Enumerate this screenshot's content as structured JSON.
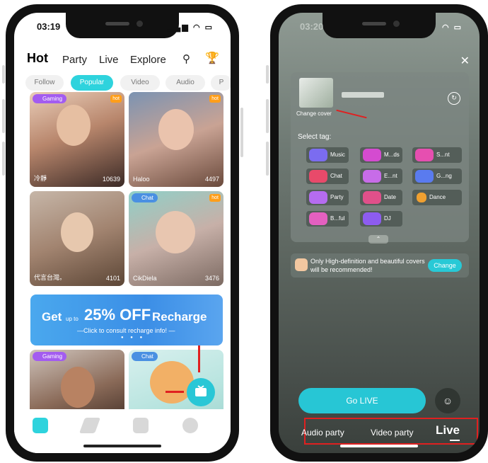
{
  "phone_a": {
    "status": {
      "time": "03:19"
    },
    "nav": {
      "hot": "Hot",
      "party": "Party",
      "live": "Live",
      "explore": "Explore"
    },
    "chips": [
      "Follow",
      "Popular",
      "Video",
      "Audio",
      "P"
    ],
    "cards": [
      {
        "badge": "Gaming",
        "fire": "hot",
        "name": "冷靜",
        "views": "10639"
      },
      {
        "badge": "",
        "fire": "hot",
        "name": "Haloo",
        "views": "4497"
      },
      {
        "badge": "",
        "fire": "",
        "name": "代言台灣。",
        "views": "4101"
      },
      {
        "badge": "Chat",
        "fire": "hot",
        "name": "CikDiela",
        "views": "3476"
      },
      {
        "badge": "Gaming",
        "fire": "",
        "name": "",
        "views": ""
      },
      {
        "badge": "Chat",
        "fire": "",
        "name": "",
        "views": ""
      }
    ],
    "banner": {
      "get": "Get",
      "upto": "up to",
      "offer": "25% OFF",
      "recharge": "Recharge",
      "sub": "—Click to consult recharge info! —"
    }
  },
  "phone_b": {
    "status": {
      "time": "03:20"
    },
    "change_cover": "Change cover",
    "select_tag": "Select tag:",
    "tags": [
      {
        "label": "Music",
        "color": "#7b6cf0"
      },
      {
        "label": "M...ds",
        "color": "#d44bd0"
      },
      {
        "label": "S...nt",
        "color": "#e64fb0"
      },
      {
        "label": "Chat",
        "color": "#e84a6a"
      },
      {
        "label": "E...nt",
        "color": "#c76ce8"
      },
      {
        "label": "G...ng",
        "color": "#5a7bef"
      },
      {
        "label": "Party",
        "color": "#b56cf0"
      },
      {
        "label": "Date",
        "color": "#e0508a"
      },
      {
        "label": "Dance",
        "color": "#f0a030"
      },
      {
        "label": "B...ful",
        "color": "#e460c0"
      },
      {
        "label": "DJ",
        "color": "#8d5cf0"
      }
    ],
    "hint": {
      "text": "Only High-definition and beautiful covers will be recommended!",
      "button": "Change"
    },
    "go_live": "Go LIVE",
    "modes": [
      "Audio party",
      "Video party",
      "Live"
    ]
  }
}
